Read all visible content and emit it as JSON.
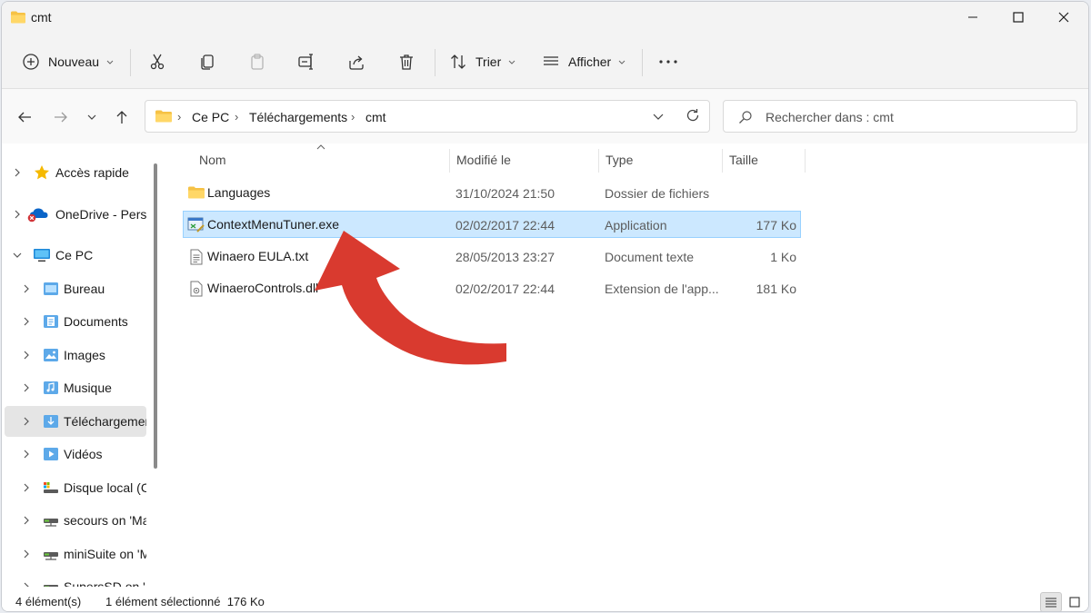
{
  "window": {
    "title": "cmt"
  },
  "toolbar": {
    "new_label": "Nouveau",
    "sort_label": "Trier",
    "view_label": "Afficher",
    "more_label": "..."
  },
  "address": {
    "crumbs": [
      "Ce PC",
      "Téléchargements",
      "cmt"
    ],
    "search_placeholder": "Rechercher dans : cmt"
  },
  "sidebar": {
    "items": [
      {
        "label": "Accès rapide",
        "icon": "star-icon"
      },
      {
        "label": "OneDrive - Perso",
        "icon": "onedrive-cloud-icon"
      },
      {
        "label": "Ce PC",
        "icon": "monitor-icon"
      },
      {
        "label": "Bureau",
        "icon": "desktop-folder-icon"
      },
      {
        "label": "Documents",
        "icon": "documents-folder-icon"
      },
      {
        "label": "Images",
        "icon": "images-folder-icon"
      },
      {
        "label": "Musique",
        "icon": "music-folder-icon"
      },
      {
        "label": "Téléchargements",
        "icon": "downloads-folder-icon"
      },
      {
        "label": "Vidéos",
        "icon": "videos-folder-icon"
      },
      {
        "label": "Disque local (C:)",
        "icon": "drive-icon"
      },
      {
        "label": "secours on 'Ma",
        "icon": "network-drive-icon"
      },
      {
        "label": "miniSuite on 'M",
        "icon": "network-drive-icon"
      },
      {
        "label": "SupersSD on 'M",
        "icon": "network-drive-icon"
      }
    ]
  },
  "columns": {
    "name": "Nom",
    "modified": "Modifié le",
    "type": "Type",
    "size": "Taille"
  },
  "files": [
    {
      "name": "Languages",
      "modified": "31/10/2024 21:50",
      "type": "Dossier de fichiers",
      "size": "",
      "icon": "folder-icon"
    },
    {
      "name": "ContextMenuTuner.exe",
      "modified": "02/02/2017 22:44",
      "type": "Application",
      "size": "177 Ko",
      "icon": "exe-icon"
    },
    {
      "name": "Winaero EULA.txt",
      "modified": "28/05/2013 23:27",
      "type": "Document texte",
      "size": "1 Ko",
      "icon": "text-file-icon"
    },
    {
      "name": "WinaeroControls.dll",
      "modified": "02/02/2017 22:44",
      "type": "Extension de l'app...",
      "size": "181 Ko",
      "icon": "dll-file-icon"
    }
  ],
  "selected_index": 1,
  "status": {
    "count": "4 élément(s)",
    "selection": "1 élément sélectionné  176 Ko"
  },
  "colors": {
    "selection_bg": "#cce8ff",
    "selection_border": "#99d1ff",
    "arrow": "#d93a2f",
    "folder": "#f6c245"
  }
}
